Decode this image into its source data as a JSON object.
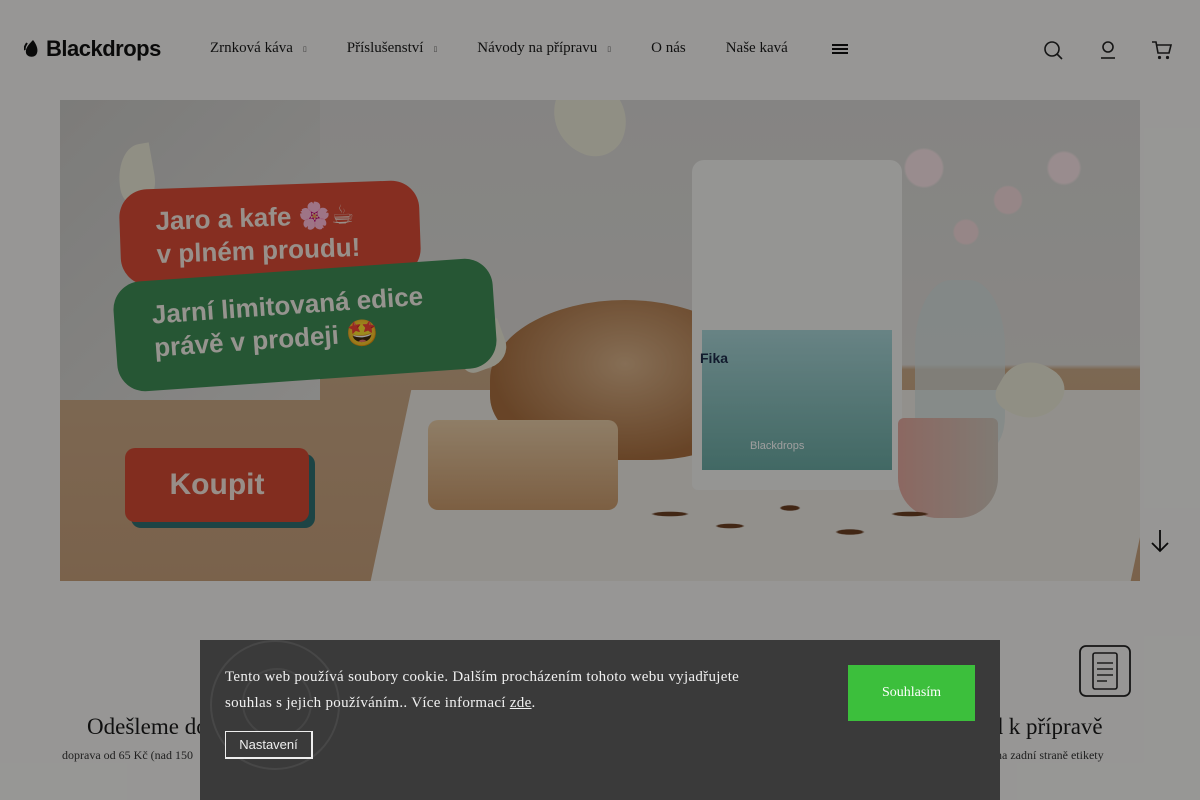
{
  "header": {
    "logo_text": "Blackdrops",
    "nav": [
      {
        "label": "Zrnková káva",
        "has_dropdown": true
      },
      {
        "label": "Příslušenství",
        "has_dropdown": true
      },
      {
        "label": "Návody na přípravu",
        "has_dropdown": true
      },
      {
        "label": "O nás",
        "has_dropdown": false
      },
      {
        "label": "Naše kavá",
        "has_dropdown": false
      }
    ],
    "caret_glyph": "▯",
    "icons": [
      "menu-icon",
      "search-icon",
      "user-icon",
      "cart-icon"
    ]
  },
  "hero": {
    "headline_line1": "Jaro a kafe 🌸☕",
    "headline_line2": "v plném proudu!",
    "subline_line1": "Jarní limitovaná edice",
    "subline_line2": "právě v prodeji 🤩",
    "cta_label": "Koupit",
    "bag_title": "Fika",
    "bag_brand": "Blackdrops",
    "colors": {
      "red": "#d84b36",
      "green": "#3e8c54",
      "teal_shadow": "#2f6f70"
    }
  },
  "features": {
    "left": {
      "title": "Odešleme do",
      "subtitle": "doprava od 65 Kč (nad 150"
    },
    "right": {
      "title": "od k přípravě",
      "subtitle": "na zadní straně etikety"
    }
  },
  "cookie": {
    "text_before_link": "Tento web používá soubory cookie. Dalším procházením tohoto webu vyjadřujete souhlas s jejich používáním.. Více informací ",
    "link_text": "zde",
    "text_after_link": ".",
    "accept_label": "Souhlasím",
    "settings_label": "Nastavení",
    "colors": {
      "background": "#3a3a3a",
      "accept": "#3cbf3c"
    }
  }
}
